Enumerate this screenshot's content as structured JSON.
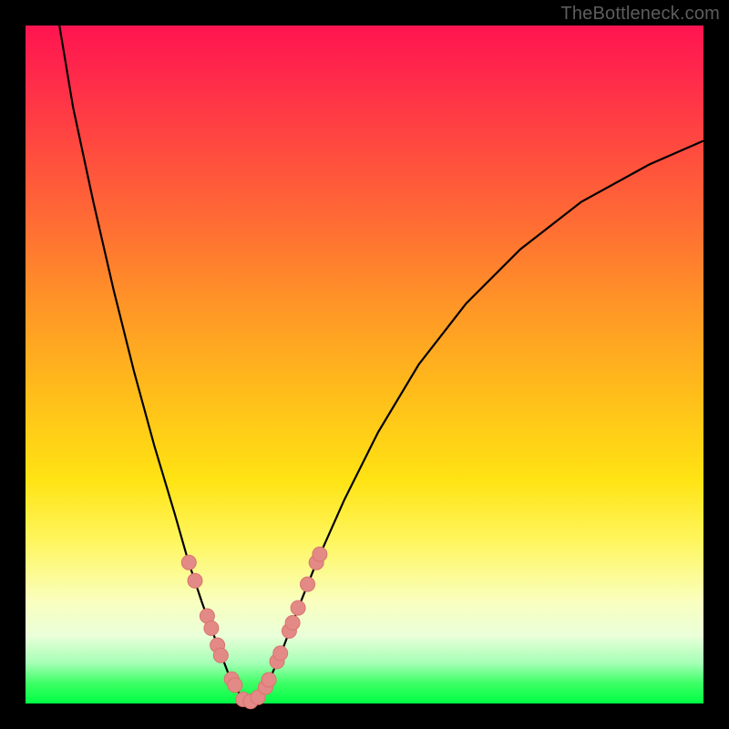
{
  "watermark": "TheBottleneck.com",
  "colors": {
    "frame": "#000000",
    "curve": "#000000",
    "marker_fill": "#e38a86",
    "marker_stroke": "#d9736f",
    "gradient_stops": [
      "#ff1450",
      "#ff2b4a",
      "#ff4a3f",
      "#ff6f33",
      "#ff9826",
      "#ffbf1a",
      "#ffe313",
      "#fff65e",
      "#f9ffbf",
      "#eaffd9",
      "#a6ffb6",
      "#3dff66",
      "#00ff44"
    ]
  },
  "chart_data": {
    "type": "line",
    "title": "",
    "xlabel": "",
    "ylabel": "",
    "xlim": [
      0,
      100
    ],
    "ylim": [
      0,
      100
    ],
    "series": [
      {
        "name": "left-branch",
        "x": [
          5,
          7,
          10,
          13,
          16,
          19,
          22,
          24,
          26,
          27.5,
          29,
          30,
          31,
          32,
          33
        ],
        "values": [
          100,
          88,
          74,
          61,
          49,
          38,
          28,
          21,
          15,
          10.8,
          6.8,
          4.2,
          2.2,
          0.9,
          0.2
        ]
      },
      {
        "name": "right-branch",
        "x": [
          33,
          34.5,
          36,
          38,
          40,
          43,
          47,
          52,
          58,
          65,
          73,
          82,
          92,
          100
        ],
        "values": [
          0.2,
          1,
          3.5,
          8.2,
          13.5,
          21,
          30,
          40,
          50,
          59,
          67,
          74,
          79.5,
          83
        ]
      }
    ],
    "markers": [
      {
        "series": "left-branch",
        "x": 24.1,
        "y": 20.8
      },
      {
        "series": "left-branch",
        "x": 25.0,
        "y": 18.1
      },
      {
        "series": "left-branch",
        "x": 26.8,
        "y": 12.9
      },
      {
        "series": "left-branch",
        "x": 27.4,
        "y": 11.1
      },
      {
        "series": "left-branch",
        "x": 28.3,
        "y": 8.6
      },
      {
        "series": "left-branch",
        "x": 28.8,
        "y": 7.1
      },
      {
        "series": "left-branch",
        "x": 30.4,
        "y": 3.6
      },
      {
        "series": "left-branch",
        "x": 30.9,
        "y": 2.7
      },
      {
        "series": "valley",
        "x": 32.1,
        "y": 0.6
      },
      {
        "series": "valley",
        "x": 33.2,
        "y": 0.3
      },
      {
        "series": "valley",
        "x": 34.3,
        "y": 0.9
      },
      {
        "series": "right-branch",
        "x": 35.4,
        "y": 2.4
      },
      {
        "series": "right-branch",
        "x": 35.9,
        "y": 3.5
      },
      {
        "series": "right-branch",
        "x": 37.1,
        "y": 6.2
      },
      {
        "series": "right-branch",
        "x": 37.6,
        "y": 7.4
      },
      {
        "series": "right-branch",
        "x": 38.9,
        "y": 10.7
      },
      {
        "series": "right-branch",
        "x": 39.4,
        "y": 11.9
      },
      {
        "series": "right-branch",
        "x": 40.2,
        "y": 14.1
      },
      {
        "series": "right-branch",
        "x": 41.6,
        "y": 17.6
      },
      {
        "series": "right-branch",
        "x": 42.9,
        "y": 20.8
      },
      {
        "series": "right-branch",
        "x": 43.4,
        "y": 22.0
      }
    ]
  }
}
